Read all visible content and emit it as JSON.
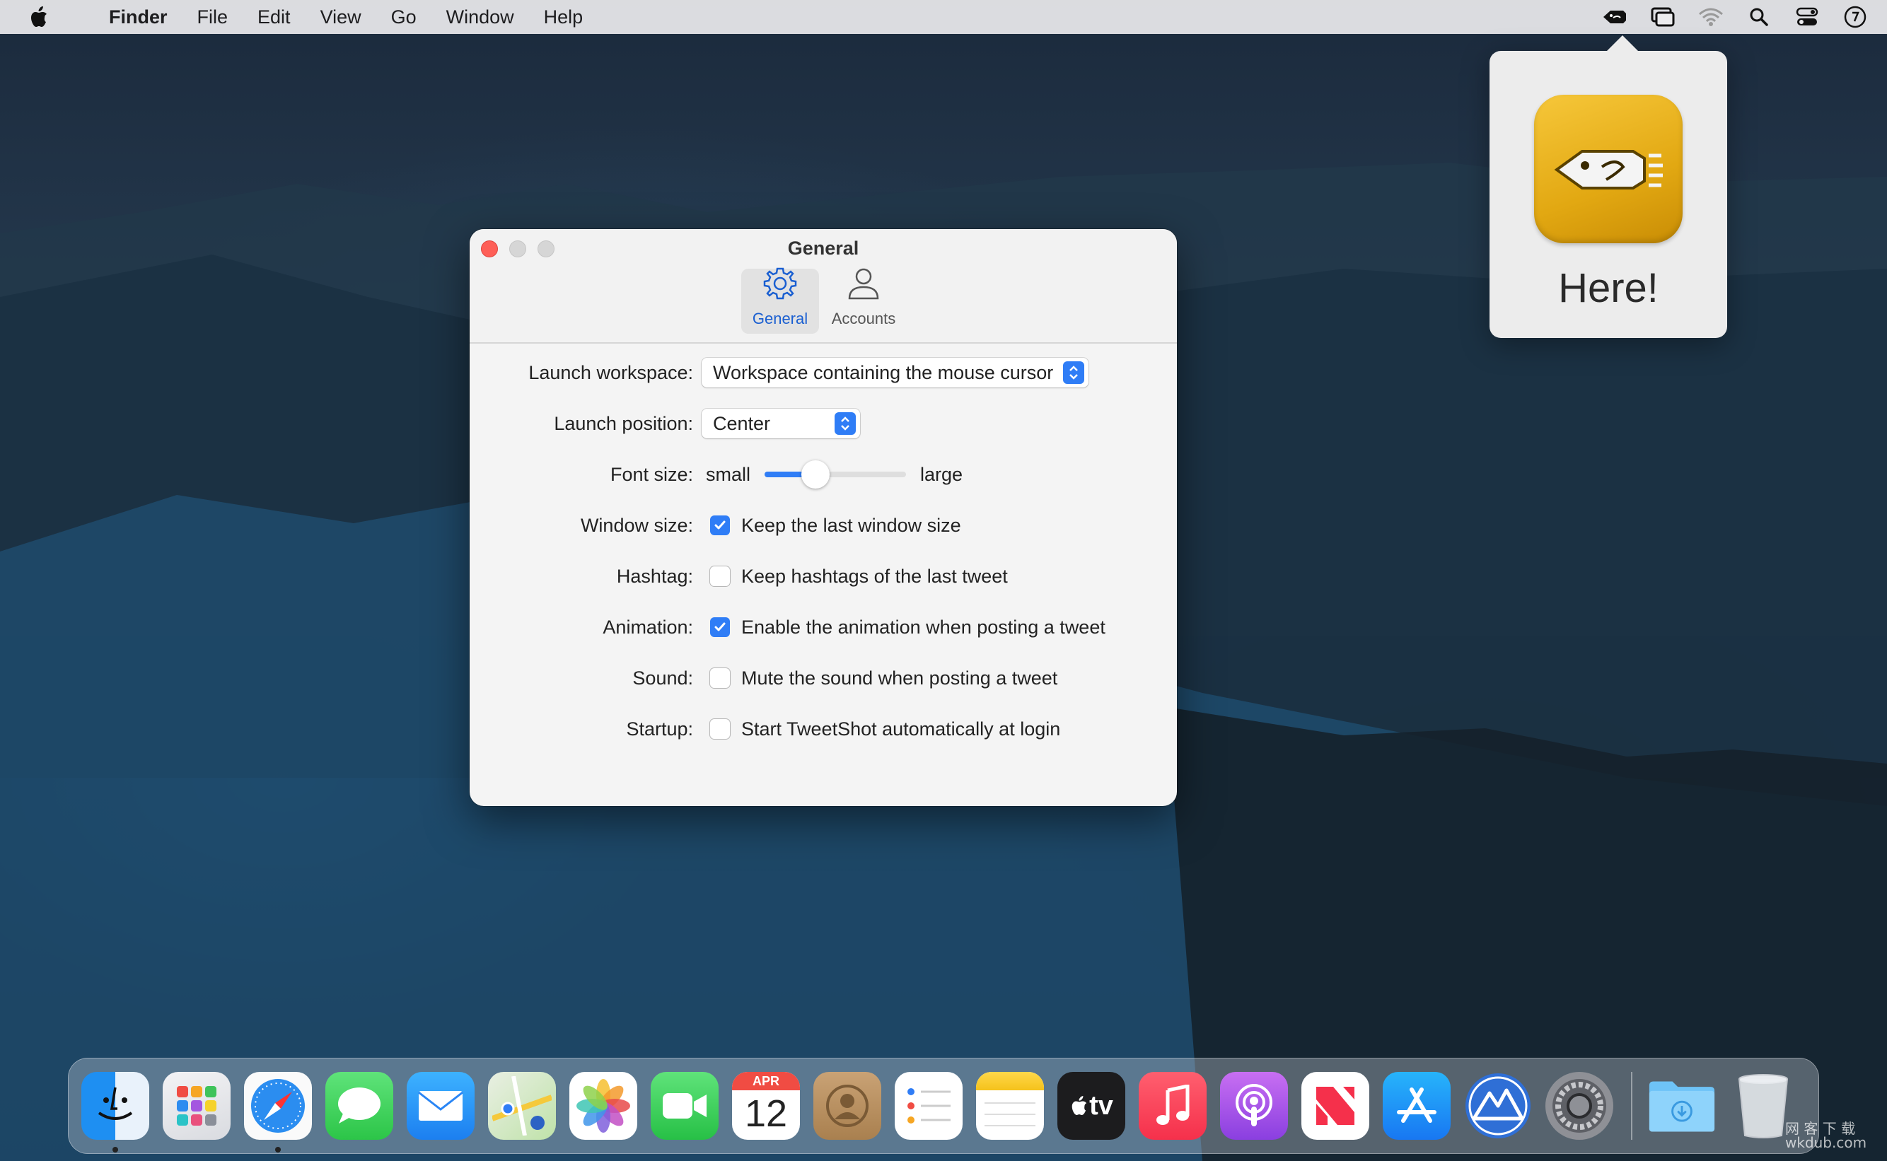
{
  "menubar": {
    "app_name": "Finder",
    "items": [
      "File",
      "Edit",
      "View",
      "Go",
      "Window",
      "Help"
    ],
    "status_icons": [
      "tweetshot-icon",
      "screen-mirror-icon",
      "wifi-icon",
      "spotlight-icon",
      "control-center-icon",
      "clock-icon"
    ]
  },
  "popover": {
    "text": "Here!"
  },
  "window": {
    "title": "General",
    "tabs": [
      {
        "label": "General",
        "icon": "gear-icon",
        "active": true
      },
      {
        "label": "Accounts",
        "icon": "person-icon",
        "active": false
      }
    ],
    "rows": {
      "launch_workspace": {
        "label": "Launch workspace:",
        "value": "Workspace containing the mouse cursor"
      },
      "launch_position": {
        "label": "Launch position:",
        "value": "Center"
      },
      "font_size": {
        "label": "Font size:",
        "min_label": "small",
        "max_label": "large",
        "level": 0.36
      },
      "window_size": {
        "label": "Window size:",
        "text": "Keep the last window size",
        "checked": true
      },
      "hashtag": {
        "label": "Hashtag:",
        "text": "Keep hashtags of the last tweet",
        "checked": false
      },
      "animation": {
        "label": "Animation:",
        "text": "Enable the animation when posting a tweet",
        "checked": true
      },
      "sound": {
        "label": "Sound:",
        "text": "Mute the sound when posting a tweet",
        "checked": false
      },
      "startup": {
        "label": "Startup:",
        "text": "Start TweetShot automatically at login",
        "checked": false
      }
    }
  },
  "dock": {
    "apps": [
      "Finder",
      "Launchpad",
      "Safari",
      "Messages",
      "Mail",
      "Maps",
      "Photos",
      "FaceTime",
      "Calendar",
      "Contacts",
      "Reminders",
      "Notes",
      "TV",
      "Music",
      "Podcasts",
      "News",
      "App Store",
      "Monterey Installer",
      "System Preferences"
    ],
    "calendar": {
      "month": "APR",
      "day": "12"
    },
    "tv_label": "tv",
    "right_items": [
      "Downloads",
      "Trash"
    ]
  },
  "colors": {
    "accent": "#2f7df6",
    "close": "#fe5f57",
    "tweetshot_yellow": "#e2a812"
  },
  "watermark": "网 客 下 载\nwkdub.com"
}
